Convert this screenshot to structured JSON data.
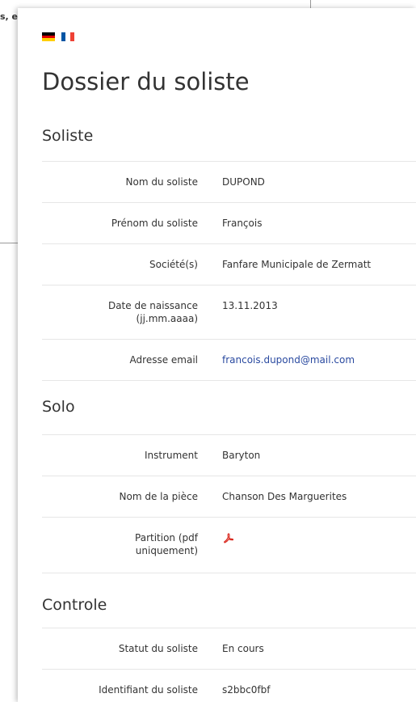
{
  "background": {
    "fragment_text": "s, e"
  },
  "languages": [
    {
      "code": "de",
      "colors": [
        "#000000",
        "#dd0000",
        "#ffce00"
      ]
    },
    {
      "code": "fr",
      "colors": [
        "#0055a4",
        "#ffffff",
        "#ef4135"
      ]
    }
  ],
  "page_title": "Dossier du soliste",
  "sections": {
    "soliste": {
      "title": "Soliste",
      "rows": [
        {
          "label": "Nom du soliste",
          "value": "DUPOND"
        },
        {
          "label": "Prénom du soliste",
          "value": "François"
        },
        {
          "label": "Société(s)",
          "value": "Fanfare Municipale de Zermatt"
        },
        {
          "label": "Date de naissance (jj.mm.aaaa)",
          "value": "13.11.2013"
        },
        {
          "label": "Adresse email",
          "value": "francois.dupond@mail.com"
        }
      ]
    },
    "solo": {
      "title": "Solo",
      "rows": [
        {
          "label": "Instrument",
          "value": "Baryton"
        },
        {
          "label": "Nom de la pièce",
          "value": "Chanson Des Marguerites"
        },
        {
          "label": "Partition (pdf uniquement)",
          "icon": "pdf-file-icon"
        }
      ]
    },
    "controle": {
      "title": "Controle",
      "rows": [
        {
          "label": "Statut du soliste",
          "value": "En cours"
        },
        {
          "label": "Identifiant du soliste",
          "value": "s2bbc0fbf"
        }
      ]
    }
  },
  "colors": {
    "text": "#333333",
    "link": "#2a4aa0",
    "divider": "#e6e6e6",
    "pdf_red": "#d9261c"
  }
}
